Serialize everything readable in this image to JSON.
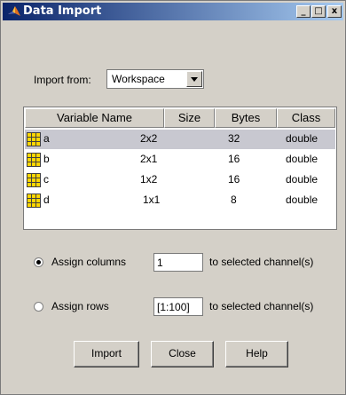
{
  "window": {
    "title": "Data Import",
    "controls": {
      "minimize": "_",
      "maximize": "□",
      "close": "x"
    }
  },
  "import_from": {
    "label": "Import from:",
    "selected": "Workspace"
  },
  "table": {
    "headers": [
      "Variable Name",
      "Size",
      "Bytes",
      "Class"
    ],
    "rows": [
      {
        "name": "a",
        "size": "2x2",
        "bytes": "32",
        "class": "double",
        "selected": true
      },
      {
        "name": "b",
        "size": "2x1",
        "bytes": "16",
        "class": "double",
        "selected": false
      },
      {
        "name": "c",
        "size": "1x2",
        "bytes": "16",
        "class": "double",
        "selected": false
      },
      {
        "name": "d",
        "size": "1x1",
        "bytes": "8",
        "class": "double",
        "selected": false
      }
    ]
  },
  "assign_columns": {
    "label": "Assign columns",
    "value": "1",
    "suffix": "to selected channel(s)",
    "checked": true
  },
  "assign_rows": {
    "label": "Assign rows",
    "value": "[1:100]",
    "suffix": "to selected channel(s)",
    "checked": false
  },
  "buttons": {
    "import": "Import",
    "close": "Close",
    "help": "Help"
  },
  "colors": {
    "titlebar_start": "#0a246a",
    "titlebar_end": "#a6caf0",
    "face": "#d4d0c8",
    "selected_row": "#c8c8d0",
    "variable_icon": "#ffd700"
  },
  "icons": {
    "window": "matlab-logo-icon",
    "variable": "grid-variable-icon"
  }
}
